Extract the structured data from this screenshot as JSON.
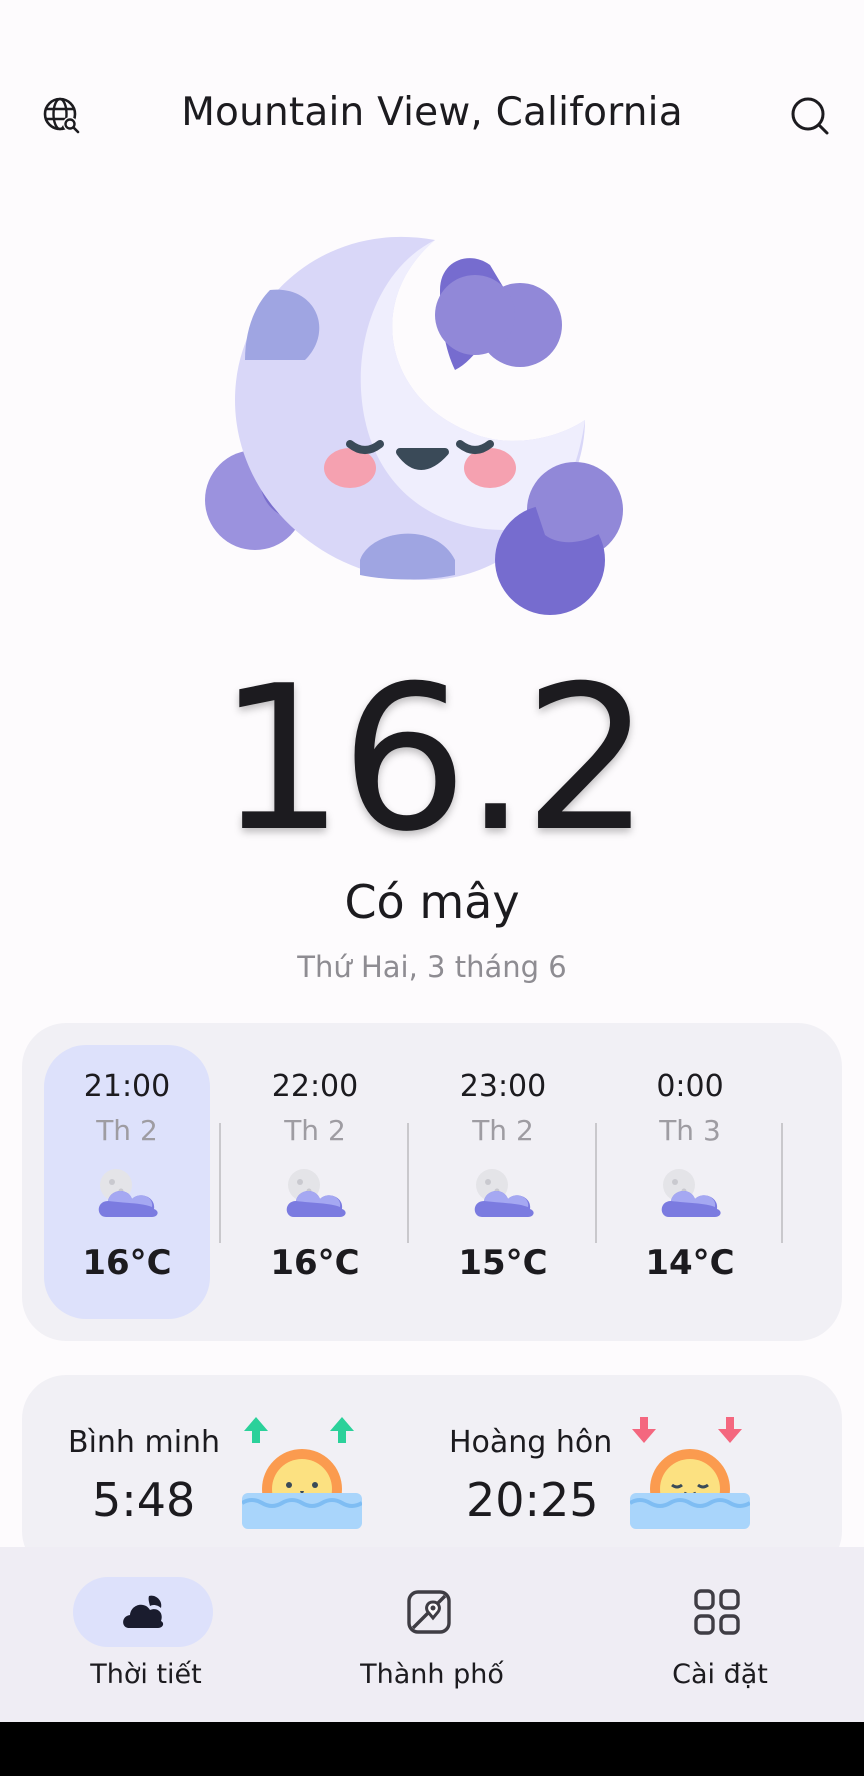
{
  "header": {
    "title": "Mountain View, California",
    "left_icon": "globe-search-icon",
    "right_icon": "search-icon"
  },
  "current": {
    "temperature": "16.2",
    "condition": "Có mây",
    "date": "Thứ Hai, 3 tháng 6",
    "icon": "sleeping-moon-icon"
  },
  "hourly": [
    {
      "time": "21:00",
      "day": "Th 2",
      "temp": "16°C",
      "icon": "night-cloudy-icon",
      "selected": true
    },
    {
      "time": "22:00",
      "day": "Th 2",
      "temp": "16°C",
      "icon": "night-cloudy-icon",
      "selected": false
    },
    {
      "time": "23:00",
      "day": "Th 2",
      "temp": "15°C",
      "icon": "night-cloudy-icon",
      "selected": false
    },
    {
      "time": "0:00",
      "day": "Th 3",
      "temp": "14°C",
      "icon": "night-cloudy-icon",
      "selected": false
    }
  ],
  "sun": {
    "sunrise_label": "Bình minh",
    "sunrise_time": "5:48",
    "sunset_label": "Hoàng hôn",
    "sunset_time": "20:25"
  },
  "nav": {
    "items": [
      {
        "label": "Thời tiết",
        "icon": "weather-icon",
        "active": true
      },
      {
        "label": "Thành phố",
        "icon": "city-map-icon",
        "active": false
      },
      {
        "label": "Cài đặt",
        "icon": "settings-grid-icon",
        "active": false
      }
    ]
  },
  "colors": {
    "background": "#fdfbfd",
    "card": "#f1f0f5",
    "accent": "#dde1fb",
    "moon_purple": "#7b6fd0"
  }
}
